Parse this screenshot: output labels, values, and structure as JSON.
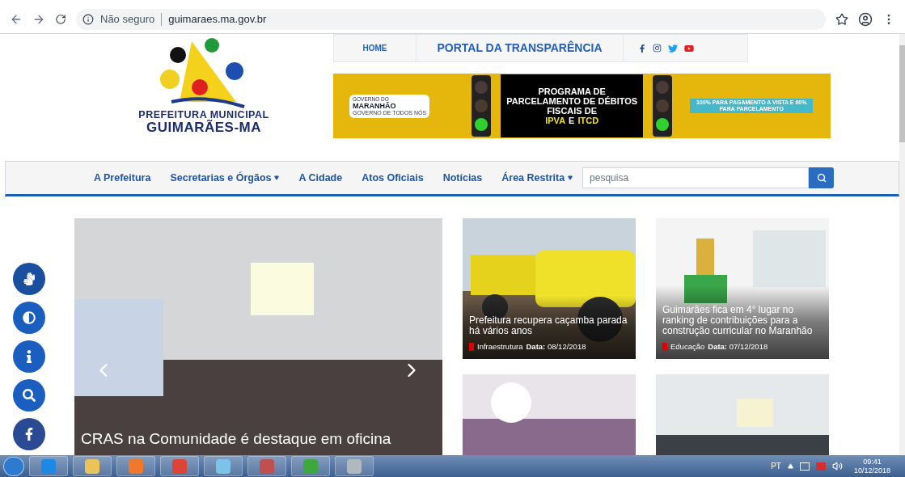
{
  "browser": {
    "security": "Não seguro",
    "url": "guimaraes.ma.gov.br"
  },
  "logo": {
    "line_1": "PREFEITURA MUNICIPAL",
    "line_2": "GUIMARÃES-MA"
  },
  "top_links": [
    {
      "label": "HOME",
      "kind": "small"
    },
    {
      "label": "PORTAL DA TRANSPARÊNCIA",
      "kind": "large"
    }
  ],
  "banner": {
    "gov_line_1": "GOVERNO DO",
    "gov_line_2": "MARANHÃO",
    "gov_slogan": "GOVERNO DE TODOS NÓS",
    "headline": "PROGRAMA DE PARCELAMENTO DE DÉBITOS FISCAIS DE",
    "tax_1": "IPVA",
    "joiner": "E",
    "tax_2": "ITCD",
    "offer": "100% PARA PAGAMENTO A VISTA E 60% PARA PARCELAMENTO"
  },
  "nav": {
    "items": [
      {
        "label": "A Prefeitura",
        "dropdown": false
      },
      {
        "label": "Secretarias e Órgãos",
        "dropdown": true
      },
      {
        "label": "A Cidade",
        "dropdown": false
      },
      {
        "label": "Atos Oficiais",
        "dropdown": false
      },
      {
        "label": "Notícias",
        "dropdown": false
      },
      {
        "label": "Área Restrita",
        "dropdown": true
      }
    ],
    "search": {
      "placeholder": "pesquisa"
    }
  },
  "slide": {
    "headline": "CRAS na Comunidade é destaque em oficina"
  },
  "news": [
    {
      "title": "Prefeitura recupera caçamba parada há vários anos",
      "category": "Infraestrutura",
      "date": "**Data:** 08/12/2018",
      "kind": "truck"
    },
    {
      "title": "Guimarães fica em 4° lugar no ranking de contribuições para a construção curricular no Maranhão",
      "category": "Educação",
      "date": "**Data:** 07/12/2018",
      "kind": "cubes"
    },
    {
      "kind": "crowd"
    },
    {
      "kind": "meeting"
    }
  ],
  "taskbar": {
    "language": "PT",
    "time": "09:41",
    "date": "10/12/2018"
  }
}
